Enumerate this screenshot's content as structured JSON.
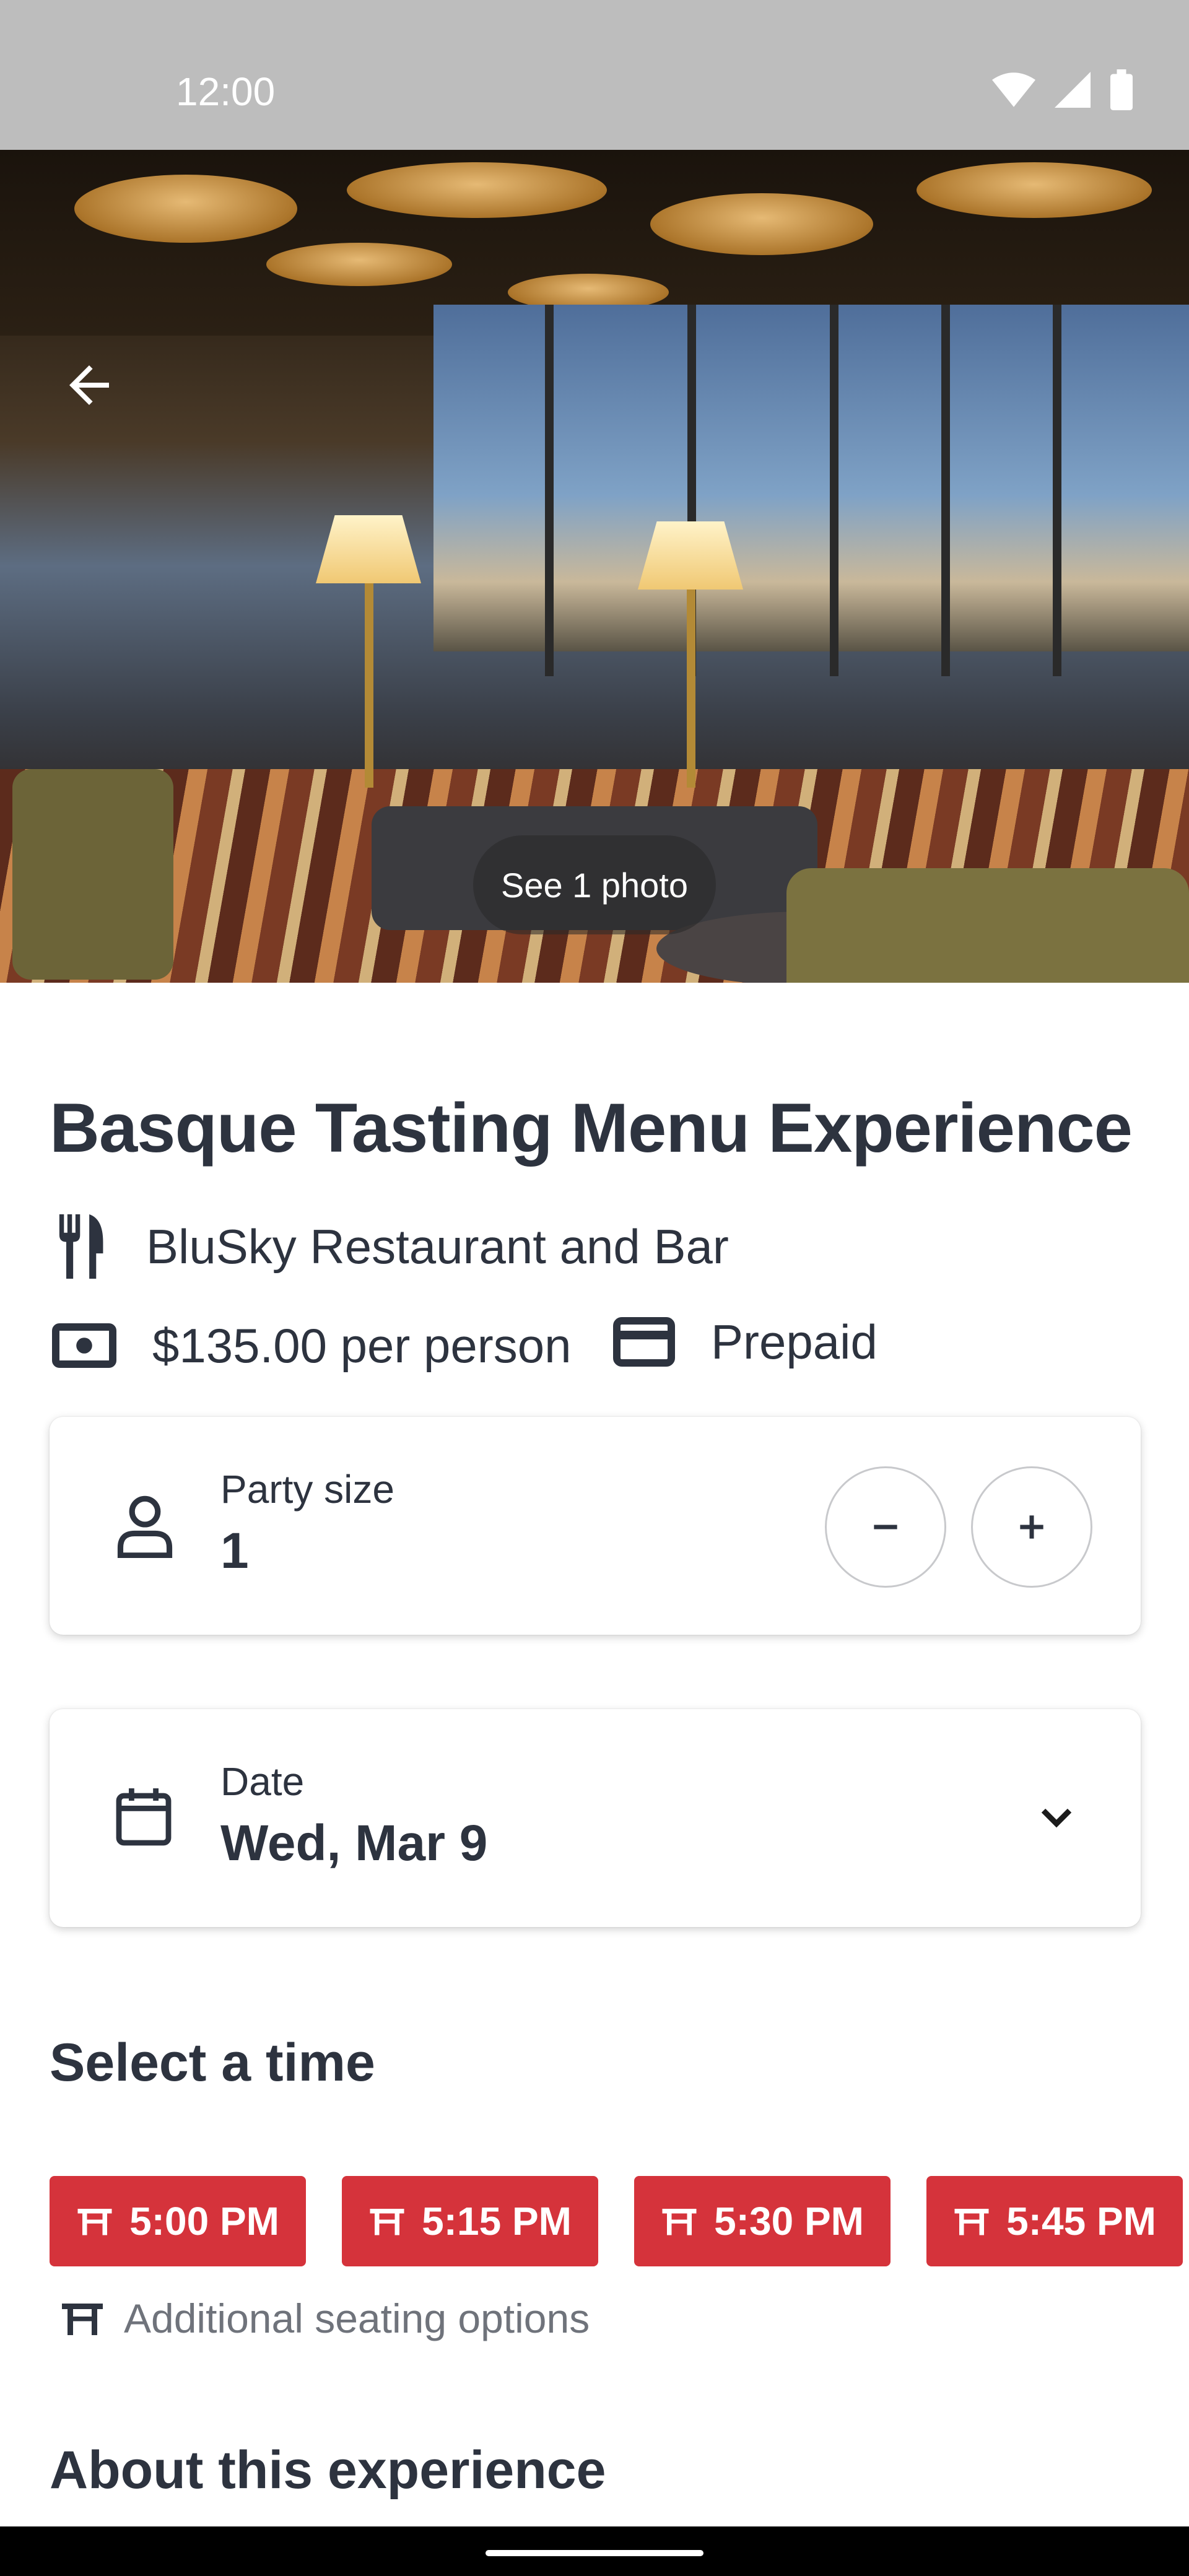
{
  "status_bar": {
    "time": "12:00"
  },
  "hero": {
    "photo_chip": "See 1 photo"
  },
  "experience": {
    "title": "Basque Tasting Menu Experience",
    "restaurant": "BluSky Restaurant and Bar",
    "price": "$135.00 per person",
    "payment": "Prepaid"
  },
  "party": {
    "label": "Party size",
    "value": "1"
  },
  "date": {
    "label": "Date",
    "value": "Wed, Mar 9"
  },
  "times": {
    "heading": "Select a time",
    "slots": [
      "5:00 PM",
      "5:15 PM",
      "5:30 PM",
      "5:45 PM"
    ],
    "additional": "Additional seating options"
  },
  "about": {
    "heading": "About this experience"
  },
  "colors": {
    "accent": "#d5333b",
    "text": "#2d333f",
    "muted": "#6f737b"
  },
  "icons": [
    "wifi-icon",
    "signal-icon",
    "battery-icon",
    "back-arrow-icon",
    "utensils-icon",
    "cash-icon",
    "credit-card-icon",
    "person-icon",
    "minus-icon",
    "plus-icon",
    "calendar-icon",
    "chevron-down-icon",
    "table-icon"
  ]
}
